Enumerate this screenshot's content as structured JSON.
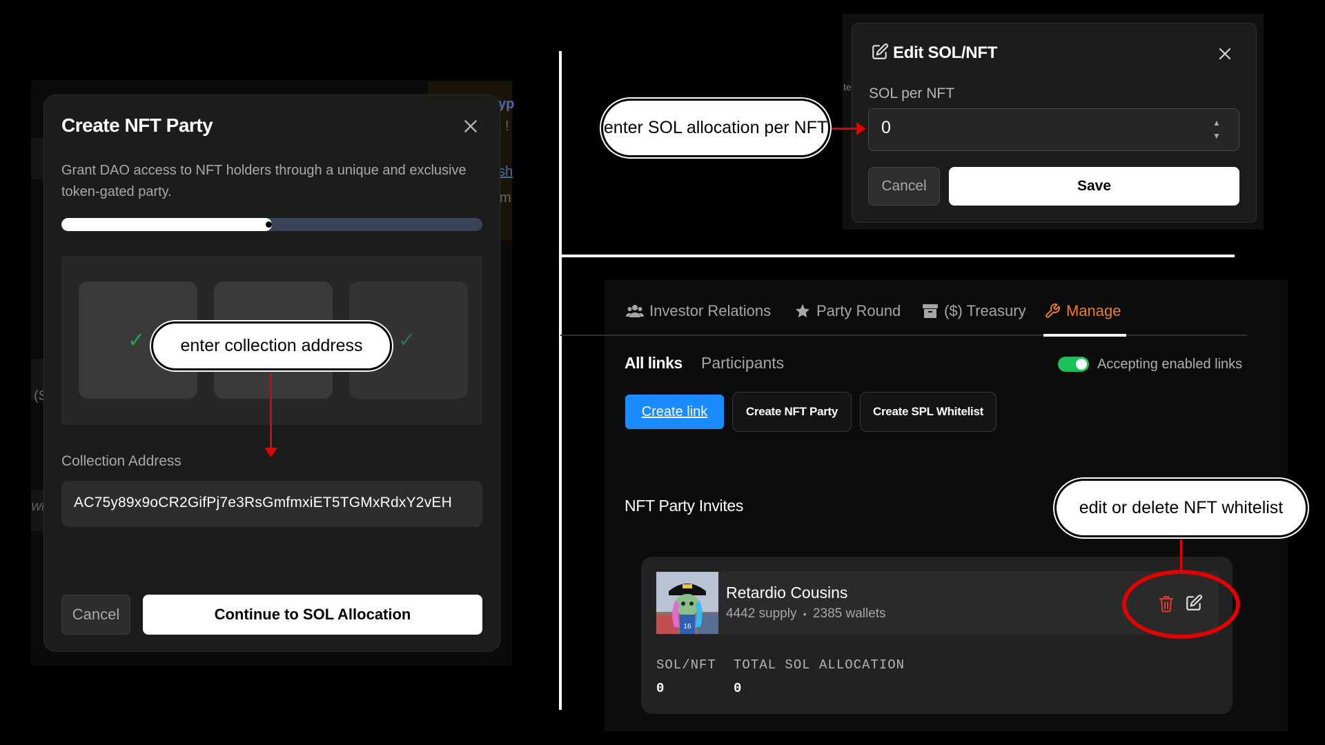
{
  "left_panel": {
    "backdrop_fragments": [
      "yp",
      "!",
      "sh",
      "m",
      "(S",
      "Wi"
    ],
    "modal": {
      "title": "Create NFT Party",
      "description": "Grant DAO access to NFT holders through a unique and exclusive token-gated party.",
      "progress_fraction": 0.5,
      "steps": [
        {
          "check": "✓"
        },
        {
          "check": ""
        },
        {
          "check": "✓"
        }
      ],
      "collection_label": "Collection Address",
      "collection_value": "AC75y89x9oCR2GifPj7e3RsGmfmxiET5TGMxRdxY2vEH",
      "cancel_label": "Cancel",
      "continue_label": "Continue to SOL Allocation"
    }
  },
  "callouts": {
    "collection": "enter collection address",
    "sol": "enter SOL allocation per NFT",
    "edit": "edit or delete NFT whitelist"
  },
  "edit_modal": {
    "backdrop_fragment": "te",
    "title": "Edit SOL/NFT",
    "field_label": "SOL per NFT",
    "field_value": "0",
    "cancel_label": "Cancel",
    "save_label": "Save"
  },
  "manage": {
    "tabs": [
      {
        "label": "Investor Relations",
        "icon": "users-icon"
      },
      {
        "label": "Party Round",
        "icon": "star-icon"
      },
      {
        "label": "($) Treasury",
        "icon": "archive-icon"
      },
      {
        "label": "Manage",
        "icon": "wrench-icon",
        "active": true
      }
    ],
    "subtabs": {
      "active": "All links",
      "inactive": "Participants"
    },
    "toggle": {
      "label": "Accepting enabled links",
      "on": true
    },
    "buttons": {
      "create_link": "Create link",
      "create_nft_party": "Create NFT Party",
      "create_spl_whitelist": "Create SPL Whitelist"
    },
    "section_title": "NFT Party Invites",
    "invite": {
      "name": "Retardio Cousins",
      "supply": "4442 supply",
      "separator": "•",
      "wallets": "2385 wallets",
      "stats": [
        {
          "label": "SOL/NFT",
          "value": "0"
        },
        {
          "label": "TOTAL SOL ALLOCATION",
          "value": "0"
        }
      ]
    }
  },
  "colors": {
    "accent_orange": "#f07c2e",
    "primary_blue": "#1a8cff",
    "toggle_green": "#19c35a",
    "annotation_red": "#e30000",
    "check_green": "#22a352"
  }
}
